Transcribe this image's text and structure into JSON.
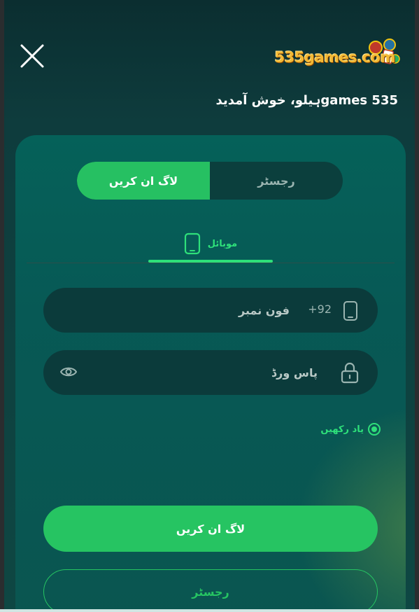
{
  "header": {
    "close_icon": "close-icon",
    "logo_text": "535games.com",
    "welcome": "535 gamesہیلو، خوش آمدید"
  },
  "auth_toggle": {
    "login_label": "لاگ ان کریں",
    "register_label": "رجسٹر",
    "active": "login"
  },
  "method_tab": {
    "label": "موبائل",
    "icon": "mobile-icon"
  },
  "form": {
    "phone": {
      "icon": "mobile-icon",
      "prefix": "+92",
      "placeholder": "فون نمبر",
      "value": ""
    },
    "password": {
      "icon": "lock-icon",
      "placeholder": "پاس ورڈ",
      "value": "",
      "toggle_icon": "eye-icon"
    },
    "remember_label": "یاد رکھیں",
    "remember_checked": true
  },
  "actions": {
    "login_button": "لاگ ان کریں",
    "register_button": "رجسٹر"
  },
  "colors": {
    "accent": "#26c462",
    "accent_text": "#2ee07a",
    "background": "#0b2e30",
    "card": "#056159",
    "field": "#0b3b3b"
  }
}
